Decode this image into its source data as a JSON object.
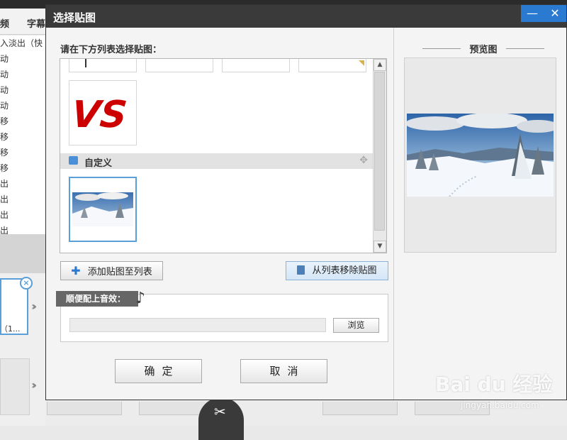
{
  "background_app": {
    "tabs": [
      "频",
      "字幕"
    ],
    "list_items": [
      "入淡出（快",
      "动",
      "动",
      "动",
      "动",
      "移",
      "移",
      "移",
      "移",
      "出",
      "出",
      "出",
      "出"
    ],
    "thumb_label": "（1..."
  },
  "dialog": {
    "title": "选择贴图",
    "win_minimize": "—",
    "win_close": "✕",
    "instruction": "请在下方列表选择贴图：",
    "section_label": "自定义",
    "vs_text": "VS",
    "add_button": "添加贴图至列表",
    "remove_button": "从列表移除贴图",
    "sound_label": "顺便配上音效：",
    "sound_path": "",
    "browse_button": "浏览",
    "ok_button": "确定",
    "cancel_button": "取消",
    "preview_heading": "预览图"
  },
  "watermark": {
    "main": "Bai du 经验",
    "sub": "jingyan.baidu.com"
  },
  "colors": {
    "accent": "#2a7ad1",
    "vs_red": "#cc0000",
    "titlebar": "#3a3a3a"
  }
}
